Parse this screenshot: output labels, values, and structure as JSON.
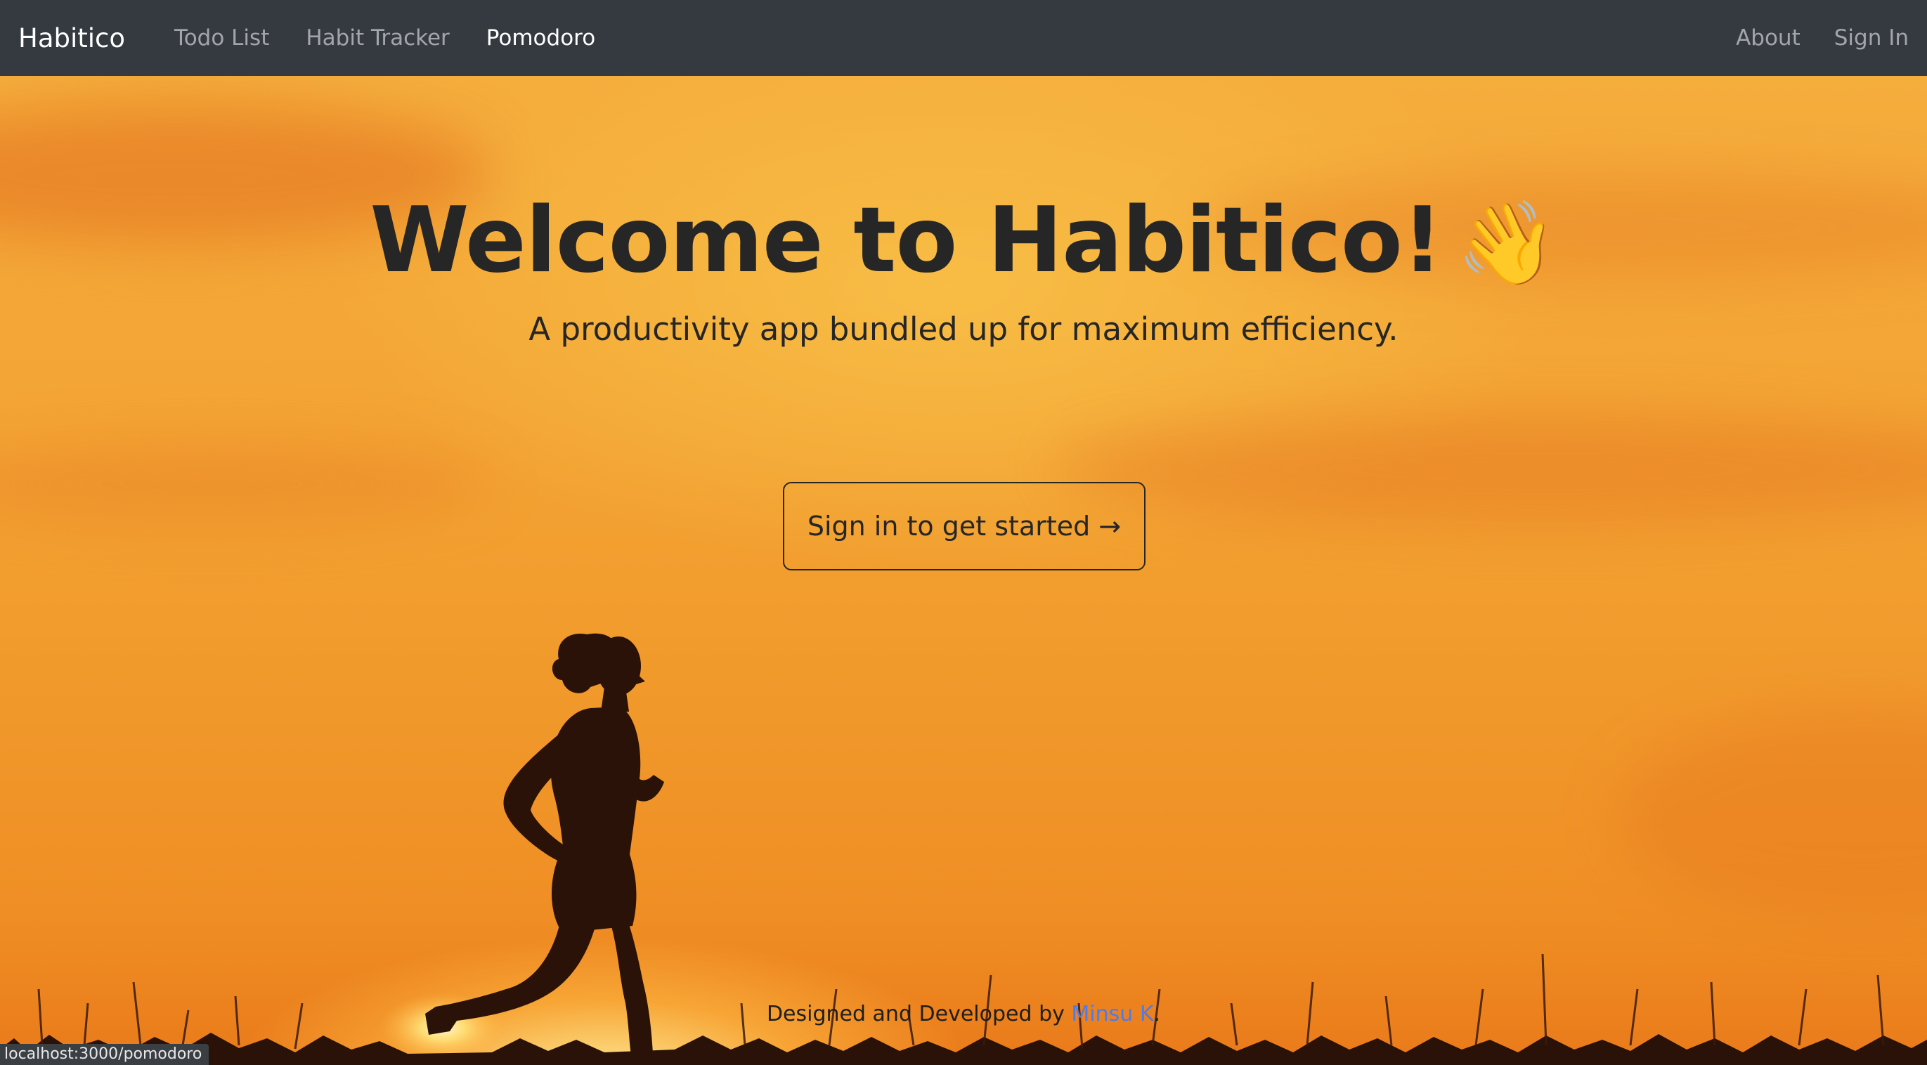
{
  "navbar": {
    "brand": "Habitico",
    "links": [
      {
        "label": "Todo List"
      },
      {
        "label": "Habit Tracker"
      },
      {
        "label": "Pomodoro"
      }
    ],
    "right_links": [
      {
        "label": "About"
      },
      {
        "label": "Sign In"
      }
    ],
    "active_link": "Pomodoro"
  },
  "hero": {
    "title": "Welcome to Habitico!",
    "title_emoji": "👋",
    "subtitle": "A productivity app bundled up for maximum efficiency.",
    "cta_label": "Sign in to get started →"
  },
  "footer": {
    "prefix": "Designed and Developed by ",
    "author": "Minsu K",
    "suffix": "."
  },
  "status_bar": {
    "url": "localhost:3000/pomodoro"
  },
  "colors": {
    "navbar_bg": "#343a40",
    "sky_orange": "#f3a434",
    "text_dark": "#262626",
    "link_blue": "#4a7cf0"
  }
}
